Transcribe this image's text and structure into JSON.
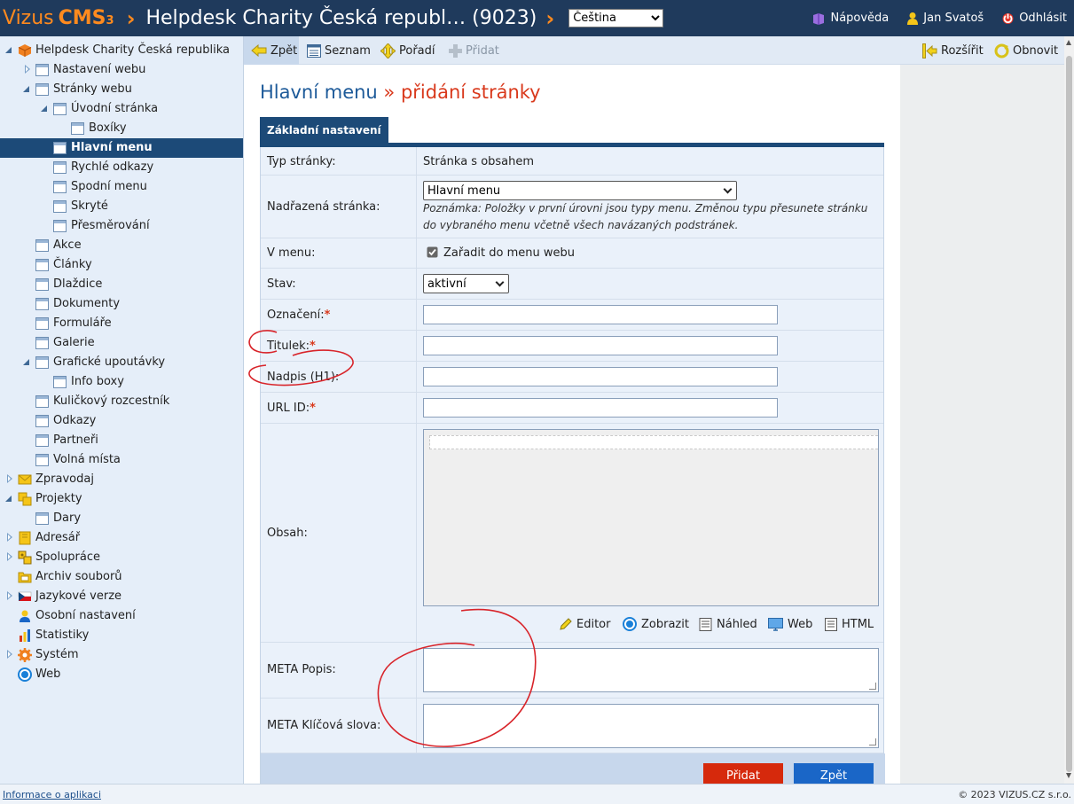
{
  "header": {
    "brand_vizus": "Vizus",
    "brand_cms": "CMS",
    "brand_sup": "3",
    "site_title": "Helpdesk Charity Česká republ… (9023)",
    "language": "Čeština",
    "help_label": "Nápověda",
    "user_label": "Jan Svatoš",
    "logout_label": "Odhlásit"
  },
  "sidebar": {
    "items": [
      {
        "label": "Helpdesk Charity Česká republika",
        "icon": "cube-icon"
      },
      {
        "label": "Nastavení webu",
        "icon": "page-icon"
      },
      {
        "label": "Stránky webu",
        "icon": "page-icon"
      },
      {
        "label": "Úvodní stránka",
        "icon": "page-icon"
      },
      {
        "label": "Boxíky",
        "icon": "page-icon"
      },
      {
        "label": "Hlavní menu",
        "icon": "page-icon"
      },
      {
        "label": "Rychlé odkazy",
        "icon": "page-icon"
      },
      {
        "label": "Spodní menu",
        "icon": "page-icon"
      },
      {
        "label": "Skryté",
        "icon": "page-icon"
      },
      {
        "label": "Přesměrování",
        "icon": "page-icon"
      },
      {
        "label": "Akce",
        "icon": "page-icon"
      },
      {
        "label": "Články",
        "icon": "page-icon"
      },
      {
        "label": "Dlaždice",
        "icon": "page-icon"
      },
      {
        "label": "Dokumenty",
        "icon": "page-icon"
      },
      {
        "label": "Formuláře",
        "icon": "page-icon"
      },
      {
        "label": "Galerie",
        "icon": "page-icon"
      },
      {
        "label": "Grafické upoutávky",
        "icon": "page-icon"
      },
      {
        "label": "Info boxy",
        "icon": "page-icon"
      },
      {
        "label": "Kuličkový rozcestník",
        "icon": "page-icon"
      },
      {
        "label": "Odkazy",
        "icon": "page-icon"
      },
      {
        "label": "Partneři",
        "icon": "page-icon"
      },
      {
        "label": "Volná místa",
        "icon": "page-icon"
      },
      {
        "label": "Zpravodaj",
        "icon": "envelope-icon"
      },
      {
        "label": "Projekty",
        "icon": "projects-icon"
      },
      {
        "label": "Dary",
        "icon": "page-icon"
      },
      {
        "label": "Adresář",
        "icon": "address-book-icon"
      },
      {
        "label": "Spolupráce",
        "icon": "cooperation-icon"
      },
      {
        "label": "Archiv souborů",
        "icon": "archive-icon"
      },
      {
        "label": "Jazykové verze",
        "icon": "flag-cz-icon"
      },
      {
        "label": "Osobní nastavení",
        "icon": "user-icon"
      },
      {
        "label": "Statistiky",
        "icon": "bar-chart-icon"
      },
      {
        "label": "Systém",
        "icon": "gear-icon"
      },
      {
        "label": "Web",
        "icon": "globe-icon"
      }
    ]
  },
  "toolbar": {
    "back": "Zpět",
    "list": "Seznam",
    "order": "Pořadí",
    "add": "Přidat",
    "expand": "Rozšířit",
    "refresh": "Obnovit"
  },
  "page": {
    "title_part1": "Hlavní menu",
    "title_sep": " » ",
    "title_part2": "přidání stránky",
    "tab": "Základní nastavení"
  },
  "form": {
    "type_label": "Typ stránky:",
    "type_value": "Stránka s obsahem",
    "parent_label": "Nadřazená stránka:",
    "parent_value": "Hlavní menu",
    "parent_note": "Poznámka: Položky v první úrovni jsou typy menu. Změnou typu přesunete stránku do vybraného menu včetně všech navázaných podstránek.",
    "menu_label": "V menu:",
    "menu_checkbox": "Zařadit do menu webu",
    "state_label": "Stav:",
    "state_value": "aktivní",
    "designation_label": "Označení:",
    "caption_label": "Titulek:",
    "heading_label": "Nadpis (H1):",
    "urlid_label": "URL ID:",
    "required_mark": "*",
    "content_label": "Obsah:",
    "editor_tools": {
      "editor": "Editor",
      "show": "Zobrazit",
      "preview": "Náhled",
      "web": "Web",
      "html": "HTML"
    },
    "meta_desc_label": "META Popis:",
    "meta_keywords_label": "META Klíčová slova:",
    "submit": "Přidat",
    "back": "Zpět"
  },
  "footer": {
    "info_link": "Informace o aplikaci",
    "copyright": "© 2023 VIZUS.CZ s.r.o."
  },
  "colors": {
    "header_bg": "#1f3a5c",
    "brand_orange": "#ff8a1e",
    "sidebar_bg": "#e5eef9",
    "active_bg": "#1c4a78",
    "title_blue": "#1d5a99",
    "title_red": "#d9391c",
    "submit_red": "#d6290c",
    "back_blue": "#1a66c7",
    "annotation_red": "#d8242a"
  }
}
